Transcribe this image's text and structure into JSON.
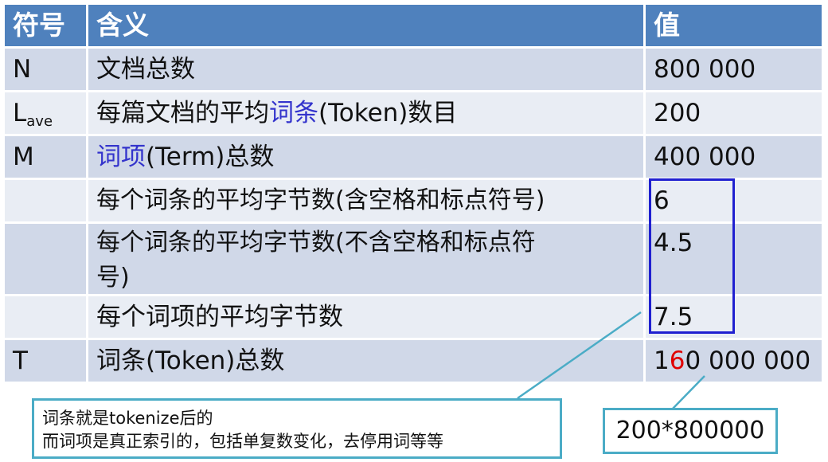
{
  "header": {
    "symbol": "符号",
    "meaning": "含义",
    "value": "值"
  },
  "rows": [
    {
      "symbol": "N",
      "meaning": "文档总数",
      "value": "800 000"
    },
    {
      "symbol": "L",
      "symbol_sub": "ave",
      "meaning_pre": "每篇文档的平均",
      "meaning_link": "词条",
      "meaning_post": "(Token)数目",
      "value": "200"
    },
    {
      "symbol": "M",
      "meaning_link": "词项",
      "meaning_post": "(Term)总数",
      "value": "400 000"
    },
    {
      "symbol": "",
      "meaning": "每个词条的平均字节数(含空格和标点符号)",
      "value": "6"
    },
    {
      "symbol": "",
      "meaning_line1": "每个词条的平均字节数(不含空格和标点符",
      "meaning_line2": "号)",
      "value": "4.5"
    },
    {
      "symbol": "",
      "meaning": "每个词项的平均字节数",
      "value": "7.5"
    },
    {
      "symbol": "T",
      "meaning": "词条(Token)总数",
      "value_a": "1",
      "value_b": "6",
      "value_c": "0 000 000"
    }
  ],
  "callout_left": {
    "line1": "词条就是tokenize后的",
    "line2": "而词项是真正索引的，包括单复数变化，去停用词等等"
  },
  "callout_right": {
    "text": "200*800000"
  },
  "colors": {
    "header": "#4f81bd",
    "row_dark": "#d0d8e8",
    "row_light": "#e9edf4",
    "highlight_box": "#2020d0",
    "callout_border": "#4bacc6",
    "red_digit": "#e00000"
  }
}
